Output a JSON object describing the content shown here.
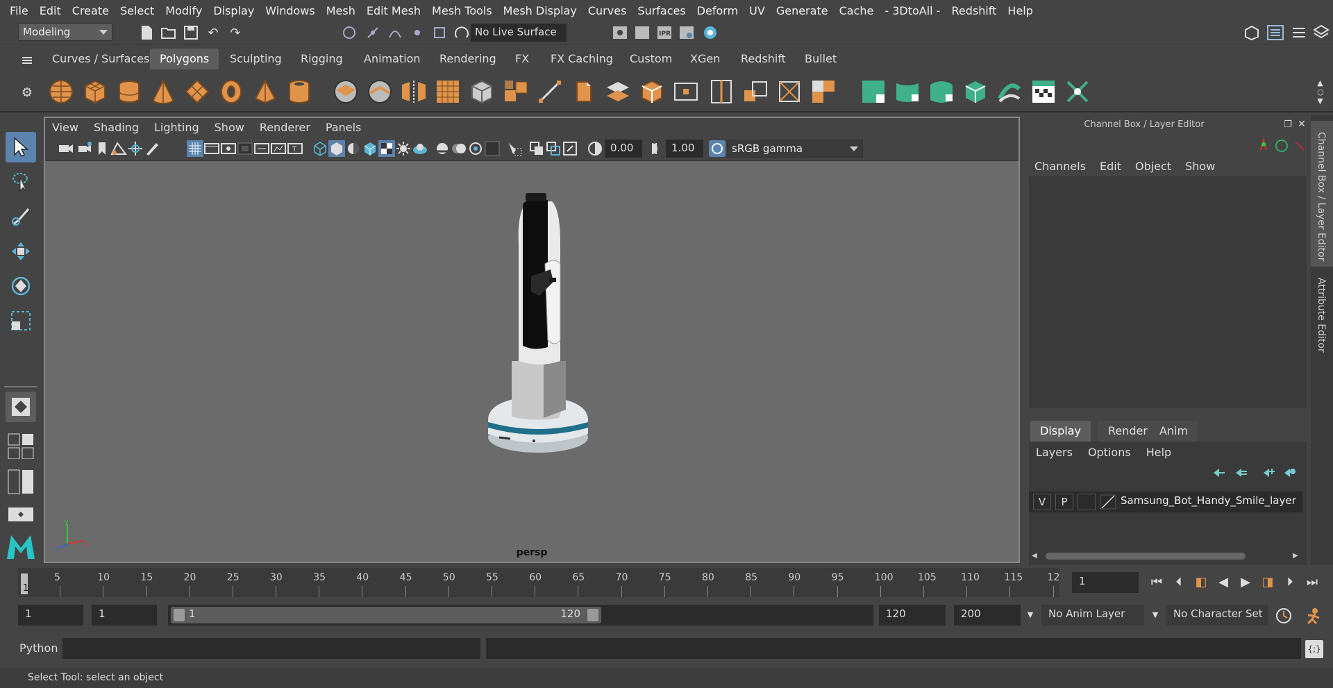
{
  "menubar": [
    "File",
    "Edit",
    "Create",
    "Select",
    "Modify",
    "Display",
    "Windows",
    "Mesh",
    "Edit Mesh",
    "Mesh Tools",
    "Mesh Display",
    "Curves",
    "Surfaces",
    "Deform",
    "UV",
    "Generate",
    "Cache",
    "- 3DtoAll -",
    "Redshift",
    "Help"
  ],
  "statusline": {
    "mode": "Modeling",
    "live_surface": "No Live Surface"
  },
  "shelf_tabs": [
    "Curves / Surfaces",
    "Polygons",
    "Sculpting",
    "Rigging",
    "Animation",
    "Rendering",
    "FX",
    "FX Caching",
    "Custom",
    "XGen",
    "Redshift",
    "Bullet"
  ],
  "shelf_active": "Polygons",
  "viewport": {
    "menu": [
      "View",
      "Shading",
      "Lighting",
      "Show",
      "Renderer",
      "Panels"
    ],
    "exposure": "0.00",
    "gamma": "1.00",
    "colorspace": "sRGB gamma",
    "camera_label": "persp"
  },
  "channel_box": {
    "title": "Channel Box / Layer Editor",
    "menu": [
      "Channels",
      "Edit",
      "Object",
      "Show"
    ]
  },
  "layer_editor": {
    "tabs": [
      "Display",
      "Render",
      "Anim"
    ],
    "menu": [
      "Layers",
      "Options",
      "Help"
    ],
    "layer": {
      "v": "V",
      "p": "P",
      "name": "Samsung_Bot_Handy_Smile_layer"
    }
  },
  "side_tabs": [
    "Channel Box / Layer Editor",
    "Attribute Editor"
  ],
  "timeline": {
    "ticks": [
      "5",
      "10",
      "15",
      "20",
      "25",
      "30",
      "35",
      "40",
      "45",
      "50",
      "55",
      "60",
      "65",
      "70",
      "75",
      "80",
      "85",
      "90",
      "95",
      "100",
      "105",
      "110",
      "115",
      "12"
    ],
    "current_marker": "1",
    "current_frame": "1"
  },
  "range": {
    "start": "1",
    "playback_start": "1",
    "slider_start": "1",
    "slider_end": "120",
    "playback_end": "120",
    "end": "200",
    "anim_layer": "No Anim Layer",
    "character_set": "No Character Set"
  },
  "command_line": {
    "label": "Python"
  },
  "help_line": "Select Tool: select an object",
  "colors": {
    "accent": "#5b83ad",
    "shelf_orange": "#e0934a",
    "shelf_green": "#3fb08a",
    "viewport_bg": "#6b6b6b"
  }
}
